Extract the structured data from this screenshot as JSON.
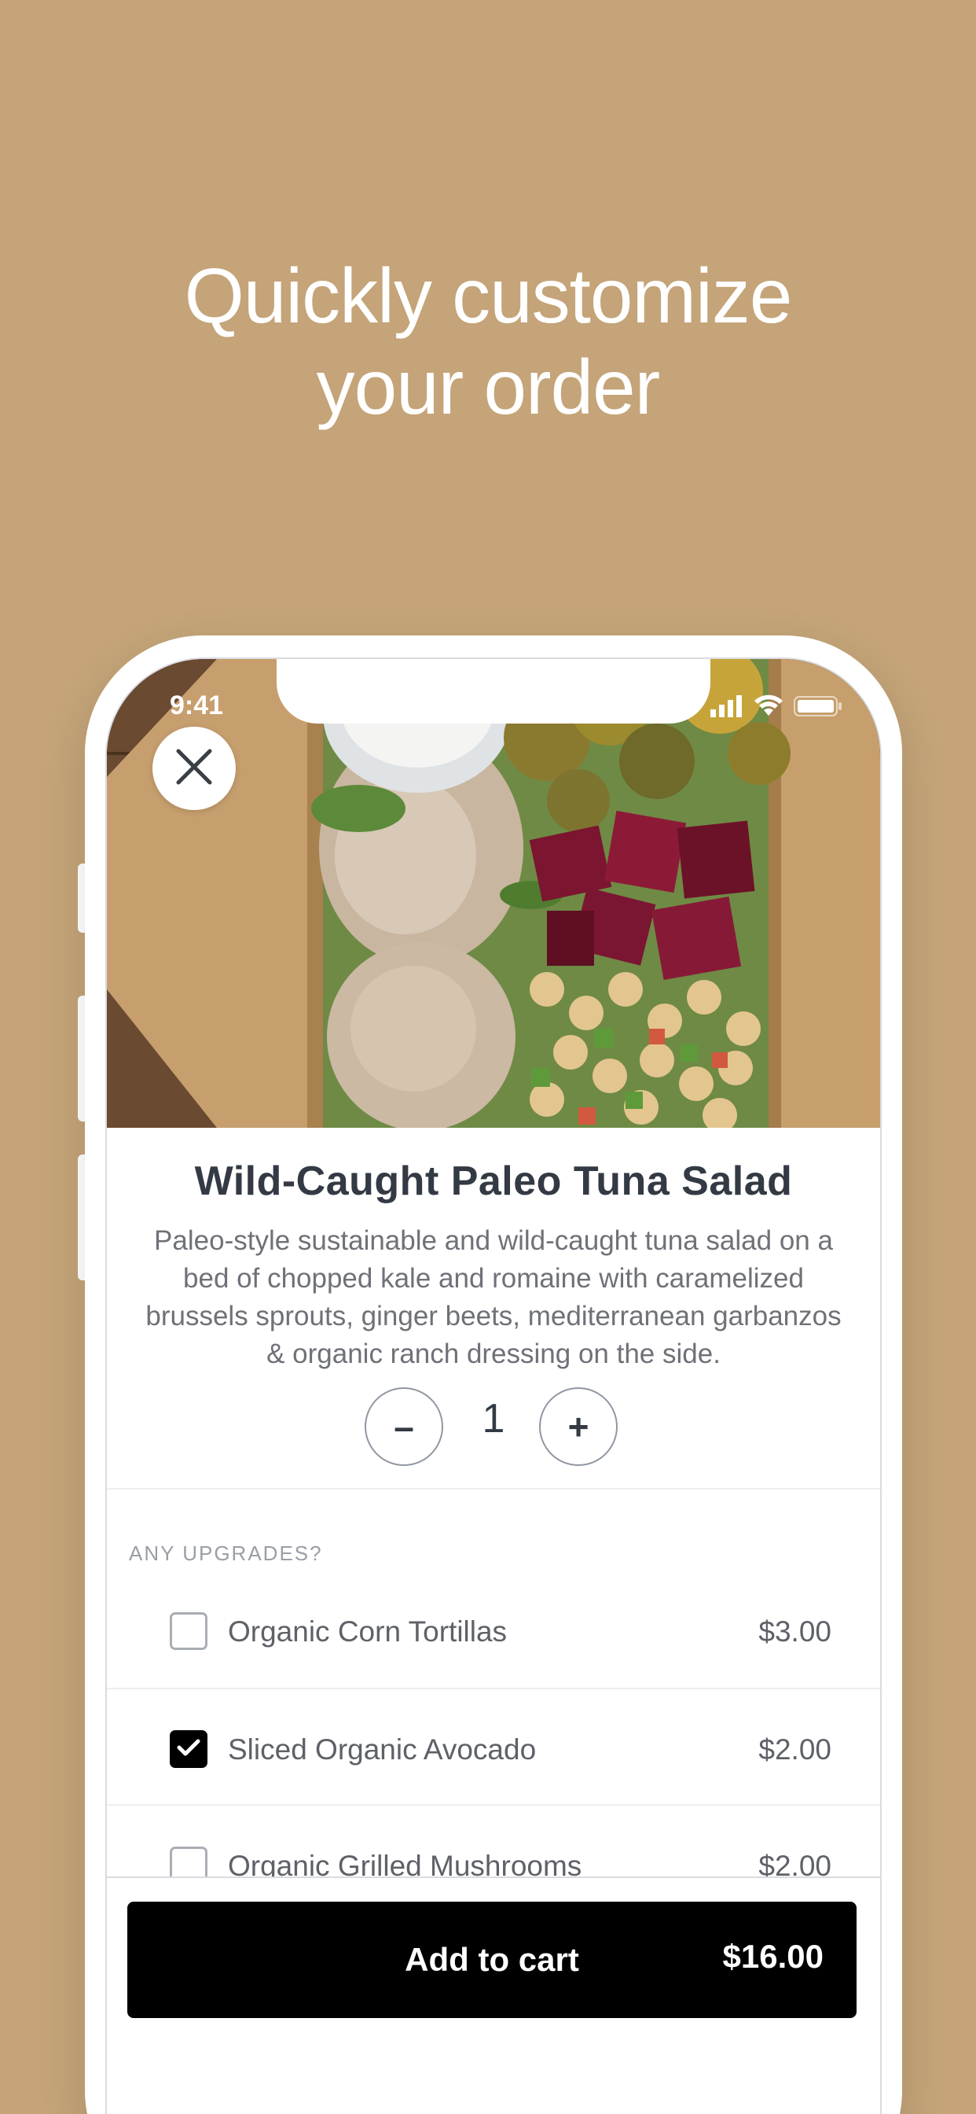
{
  "promo": {
    "headline_line1": "Quickly customize",
    "headline_line2": "your order"
  },
  "status_bar": {
    "time": "9:41"
  },
  "product": {
    "title": "Wild-Caught Paleo Tuna Salad",
    "description": "Paleo-style sustainable and wild-caught tuna salad on a bed of chopped kale and romaine with caramelized brussels sprouts, ginger beets, mediterranean garbanzos & organic ranch dressing on the side.",
    "quantity": "1",
    "decrement_label": "–",
    "increment_label": "+"
  },
  "upgrades": {
    "section_label": "ANY UPGRADES?",
    "items": [
      {
        "name": "Organic Corn Tortillas",
        "price": "$3.00",
        "checked": false
      },
      {
        "name": "Sliced Organic Avocado",
        "price": "$2.00",
        "checked": true
      },
      {
        "name": "Organic Grilled Mushrooms",
        "price": "$2.00",
        "checked": false
      }
    ]
  },
  "cart": {
    "button_label": "Add to cart",
    "total": "$16.00"
  },
  "colors": {
    "background": "#c4a478",
    "button": "#000000",
    "title_text": "#333a44"
  },
  "icons": [
    "close-icon",
    "signal-icon",
    "wifi-icon",
    "battery-icon",
    "checkmark-icon"
  ]
}
